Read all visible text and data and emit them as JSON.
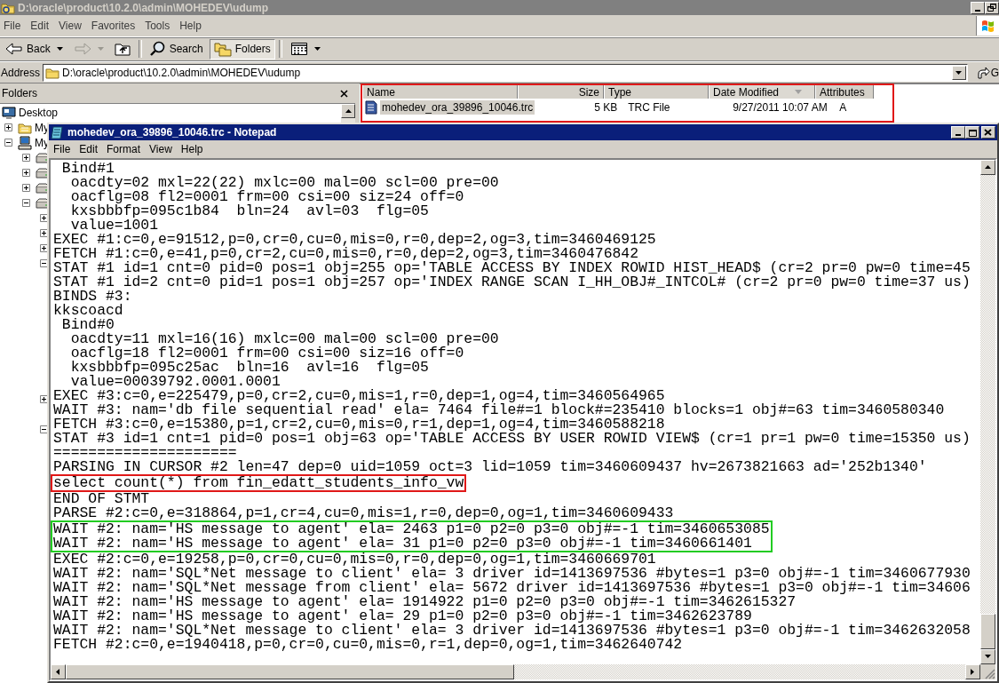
{
  "explorer": {
    "title": "D:\\oracle\\product\\10.2.0\\admin\\MOHEDEV\\udump",
    "menu": [
      "File",
      "Edit",
      "View",
      "Favorites",
      "Tools",
      "Help"
    ],
    "toolbar": [
      {
        "kind": "back",
        "label": "Back",
        "disabled": false,
        "pressed": false
      },
      {
        "kind": "forward",
        "disabled": true,
        "pressed": false
      },
      {
        "kind": "up",
        "disabled": false,
        "pressed": false
      },
      {
        "kind": "search",
        "label": "Search",
        "disabled": false,
        "pressed": false
      },
      {
        "kind": "folders",
        "label": "Folders",
        "disabled": false,
        "pressed": true
      },
      {
        "kind": "views",
        "disabled": false,
        "pressed": false
      }
    ],
    "address": {
      "label": "Address",
      "value": "D:\\oracle\\product\\10.2.0\\admin\\MOHEDEV\\udump",
      "go_label": "G"
    },
    "folders_pane": {
      "title": "Folders",
      "tree": [
        {
          "kind": "desktop",
          "label": "Desktop",
          "children": [
            {
              "kind": "documents",
              "label": "My",
              "expanded": false
            },
            {
              "kind": "computer",
              "label": "My",
              "expanded": true,
              "children": [
                {
                  "kind": "drive",
                  "expanded": false
                },
                {
                  "kind": "drive",
                  "expanded": false
                },
                {
                  "kind": "drive",
                  "expanded": false
                },
                {
                  "kind": "drive",
                  "expanded": true,
                  "children": [
                    {
                      "kind": "item",
                      "expanded": false
                    },
                    {
                      "kind": "item",
                      "expanded": false
                    },
                    {
                      "kind": "item",
                      "expanded": false
                    },
                    {
                      "kind": "item",
                      "expanded": true
                    },
                    {
                      "kind": "leaf"
                    },
                    {
                      "kind": "leaf"
                    },
                    {
                      "kind": "leaf"
                    },
                    {
                      "kind": "leaf"
                    },
                    {
                      "kind": "leaf"
                    },
                    {
                      "kind": "leaf"
                    },
                    {
                      "kind": "leaf"
                    },
                    {
                      "kind": "leaf"
                    },
                    {
                      "kind": "item",
                      "expanded": false
                    },
                    {
                      "kind": "leaf"
                    },
                    {
                      "kind": "item",
                      "expanded": true
                    }
                  ]
                }
              ]
            }
          ]
        }
      ]
    },
    "file_list": {
      "columns": [
        {
          "label": "Name",
          "sorted": false
        },
        {
          "label": "Size",
          "sorted": false
        },
        {
          "label": "Type",
          "sorted": false
        },
        {
          "label": "Date Modified",
          "sorted": true
        },
        {
          "label": "Attributes",
          "sorted": false
        }
      ],
      "rows": [
        {
          "selected": true,
          "cells": [
            "mohedev_ora_39896_10046.trc",
            "5 KB",
            "TRC File",
            "9/27/2011 10:07 AM",
            "A"
          ]
        }
      ]
    }
  },
  "notepad": {
    "title": "mohedev_ora_39896_10046.trc - Notepad",
    "menu": [
      "File",
      "Edit",
      "Format",
      "View",
      "Help"
    ],
    "segments": [
      {
        "lines": [
          " Bind#1",
          "  oacdty=02 mxl=22(22) mxlc=00 mal=00 scl=00 pre=00",
          "  oacflg=08 fl2=0001 frm=00 csi=00 siz=24 off=0",
          "  kxsbbbfp=095c1b84  bln=24  avl=03  flg=05",
          "  value=1001",
          "EXEC #1:c=0,e=91512,p=0,cr=0,cu=0,mis=0,r=0,dep=2,og=3,tim=3460469125",
          "FETCH #1:c=0,e=41,p=0,cr=2,cu=0,mis=0,r=0,dep=2,og=3,tim=3460476842",
          "STAT #1 id=1 cnt=0 pid=0 pos=1 obj=255 op='TABLE ACCESS BY INDEX ROWID HIST_HEAD$ (cr=2 pr=0 pw=0 time=45",
          "STAT #1 id=2 cnt=0 pid=1 pos=1 obj=257 op='INDEX RANGE SCAN I_HH_OBJ#_INTCOL# (cr=2 pr=0 pw=0 time=37 us)",
          "BINDS #3:",
          "kkscoacd",
          " Bind#0",
          "  oacdty=11 mxl=16(16) mxlc=00 mal=00 scl=00 pre=00",
          "  oacflg=18 fl2=0001 frm=00 csi=00 siz=16 off=0",
          "  kxsbbbfp=095c25ac  bln=16  avl=16  flg=05",
          "  value=00039792.0001.0001",
          "EXEC #3:c=0,e=225479,p=0,cr=2,cu=0,mis=1,r=0,dep=1,og=4,tim=3460564965",
          "WAIT #3: nam='db file sequential read' ela= 7464 file#=1 block#=235410 blocks=1 obj#=63 tim=3460580340",
          "FETCH #3:c=0,e=15380,p=1,cr=2,cu=0,mis=0,r=1,dep=1,og=4,tim=3460588218",
          "STAT #3 id=1 cnt=1 pid=0 pos=1 obj=63 op='TABLE ACCESS BY USER ROWID VIEW$ (cr=1 pr=1 pw=0 time=15350 us)",
          "=====================",
          "PARSING IN CURSOR #2 len=47 dep=0 uid=1059 oct=3 lid=1059 tim=3460609437 hv=2673821663 ad='252b1340'"
        ]
      },
      {
        "color": "#e01818",
        "lines": [
          "select count(*) from fin_edatt_students_info_vw"
        ]
      },
      {
        "lines": [
          "END OF STMT",
          "PARSE #2:c=0,e=318864,p=1,cr=4,cu=0,mis=1,r=0,dep=0,og=1,tim=3460609433"
        ]
      },
      {
        "color": "#22cc22",
        "lines": [
          "WAIT #2: nam='HS message to agent' ela= 2463 p1=0 p2=0 p3=0 obj#=-1 tim=3460653085",
          "WAIT #2: nam='HS message to agent' ela= 31 p1=0 p2=0 p3=0 obj#=-1 tim=3460661401"
        ]
      },
      {
        "lines": [
          "EXEC #2:c=0,e=19258,p=0,cr=0,cu=0,mis=0,r=0,dep=0,og=1,tim=3460669701",
          "WAIT #2: nam='SQL*Net message to client' ela= 3 driver id=1413697536 #bytes=1 p3=0 obj#=-1 tim=3460677930",
          "WAIT #2: nam='SQL*Net message from client' ela= 5672 driver id=1413697536 #bytes=1 p3=0 obj#=-1 tim=34606",
          "WAIT #2: nam='HS message to agent' ela= 1914922 p1=0 p2=0 p3=0 obj#=-1 tim=3462615327",
          "WAIT #2: nam='HS message to agent' ela= 29 p1=0 p2=0 p3=0 obj#=-1 tim=3462623789",
          "WAIT #2: nam='SQL*Net message to client' ela= 3 driver id=1413697536 #bytes=1 p3=0 obj#=-1 tim=3462632058",
          "FETCH #2:c=0,e=1940418,p=0,cr=0,cu=0,mis=0,r=1,dep=0,og=1,tim=3462640742"
        ]
      }
    ]
  }
}
